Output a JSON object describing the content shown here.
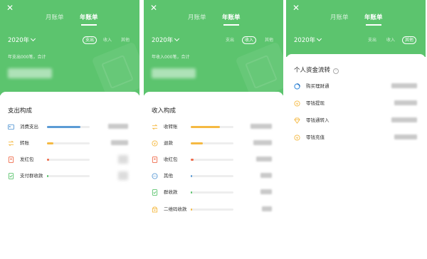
{
  "panels": [
    {
      "close": "✕",
      "tabs": {
        "monthly": "月账单",
        "yearly": "年账单"
      },
      "year": "2020年",
      "filters": [
        "支出",
        "收入",
        "其他"
      ],
      "subtitle": "年支出000笔，合计",
      "section_title": "支出构成",
      "rows": [
        {
          "label": "消费支出",
          "icon": "card-icon",
          "color": "#5b9bd5",
          "fill": 0.78
        },
        {
          "label": "转账",
          "icon": "transfer-icon",
          "color": "#f5b942",
          "fill": 0.15
        },
        {
          "label": "发红包",
          "icon": "red-packet-icon",
          "color": "#ef6b4b",
          "fill": 0.05
        },
        {
          "label": "支付群收款",
          "icon": "group-pay-icon",
          "color": "#5cc46e",
          "fill": 0.04
        }
      ]
    },
    {
      "close": "✕",
      "tabs": {
        "monthly": "月账单",
        "yearly": "年账单"
      },
      "year": "2020年",
      "filters": [
        "支出",
        "收入",
        "其他"
      ],
      "subtitle": "年收入000笔，合计",
      "section_title": "收入构成",
      "rows": [
        {
          "label": "收转账",
          "icon": "transfer-icon",
          "color": "#f5b942",
          "fill": 0.68
        },
        {
          "label": "退款",
          "icon": "refund-icon",
          "color": "#f5b942",
          "fill": 0.28
        },
        {
          "label": "收红包",
          "icon": "red-packet-icon",
          "color": "#ef6b4b",
          "fill": 0.06
        },
        {
          "label": "其他",
          "icon": "other-icon",
          "color": "#5b9bd5",
          "fill": 0.03
        },
        {
          "label": "群收款",
          "icon": "group-pay-icon",
          "color": "#5cc46e",
          "fill": 0.03
        },
        {
          "label": "二维码收款",
          "icon": "qr-pay-icon",
          "color": "#f5b942",
          "fill": 0.03
        }
      ]
    },
    {
      "close": "✕",
      "tabs": {
        "monthly": "月账单",
        "yearly": "年账单"
      },
      "year": "2020年",
      "filters": [
        "支出",
        "收入",
        "其他"
      ],
      "section_title": "个人资金流转",
      "rows": [
        {
          "label": "购买理财通",
          "icon": "wealth-icon",
          "color": "#3b8fe0"
        },
        {
          "label": "零钱提现",
          "icon": "withdraw-icon",
          "color": "#f5b942"
        },
        {
          "label": "零钱通转入",
          "icon": "lingqiantong-icon",
          "color": "#f5b942"
        },
        {
          "label": "零钱充值",
          "icon": "topup-icon",
          "color": "#f5b942"
        }
      ]
    }
  ],
  "colors": {
    "header_green": "#5cc46e",
    "active_filter_index": [
      0,
      1,
      2
    ]
  }
}
